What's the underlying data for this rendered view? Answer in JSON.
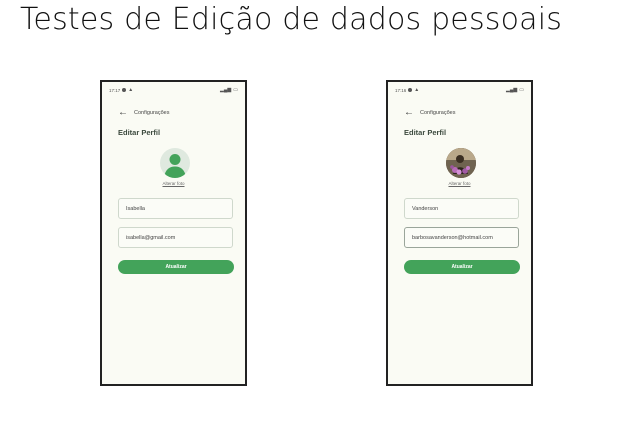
{
  "slide": {
    "title": "Testes de Edição de dados pessoais"
  },
  "phones": [
    {
      "status_time": "17:17",
      "appbar_title": "Configurações",
      "screen_title": "Editar Perfil",
      "change_photo": "Alterar foto",
      "name_value": "Isabella",
      "email_value": "isabella@gmail.com",
      "button_label": "Atualizar",
      "avatar": "person-placeholder-icon"
    },
    {
      "status_time": "17:16",
      "appbar_title": "Configurações",
      "screen_title": "Editar Perfil",
      "change_photo": "Alterar foto",
      "name_value": "Vanderson",
      "email_value": "barbosavanderson@hotmail.com",
      "button_label": "Atualizar",
      "avatar": "profile-photo"
    }
  ],
  "colors": {
    "accent": "#43a35a",
    "screen_bg": "#fafbf4",
    "avatar_bg": "#dfe9df"
  }
}
